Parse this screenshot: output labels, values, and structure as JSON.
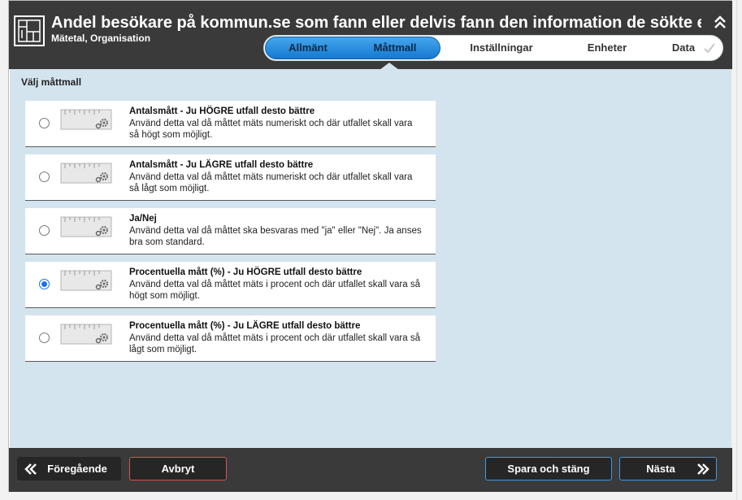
{
  "header": {
    "title": "Andel besökare på kommun.se som fann eller delvis fann den information de sökte efter",
    "subtitle": "Mätetal, Organisation"
  },
  "tabs": [
    {
      "label": "Allmänt",
      "active": false,
      "completed": true
    },
    {
      "label": "Måttmall",
      "active": true,
      "completed": true
    },
    {
      "label": "Inställningar",
      "active": false,
      "completed": false
    },
    {
      "label": "Enheter",
      "active": false,
      "completed": false
    },
    {
      "label": "Data",
      "active": false,
      "completed": false
    }
  ],
  "content": {
    "section_label": "Välj måttmall",
    "options": [
      {
        "title": "Antalsmått - Ju HÖGRE utfall desto bättre",
        "description": "Använd detta val då måttet mäts numeriskt och där utfallet skall vara så högt som möjligt.",
        "selected": false
      },
      {
        "title": "Antalsmått - Ju LÄGRE utfall desto bättre",
        "description": "Använd detta val då måttet mäts numeriskt och där utfallet skall vara så lågt som möjligt.",
        "selected": false
      },
      {
        "title": "Ja/Nej",
        "description": "Använd detta val då måttet ska besvaras med \"ja\" eller \"Nej\". Ja anses bra som standard.",
        "selected": false
      },
      {
        "title": "Procentuella mått (%) - Ju HÖGRE utfall desto bättre",
        "description": "Använd detta val då måttet mäts i procent och där utfallet skall vara så högt som möjligt.",
        "selected": true
      },
      {
        "title": "Procentuella mått (%) - Ju LÄGRE utfall desto bättre",
        "description": "Använd detta val då måttet mäts i procent och där utfallet skall vara så lågt som möjligt.",
        "selected": false
      }
    ]
  },
  "footer": {
    "prev_label": "Föregående",
    "cancel_label": "Avbryt",
    "save_label": "Spara och stäng",
    "next_label": "Nästa"
  },
  "icons": {
    "app": "measure-table-icon",
    "collapse": "double-chevron-up-icon",
    "tab_check": "checkmark-icon",
    "option": "ruler-gear-icon",
    "prev": "double-chevron-left-icon",
    "next": "double-chevron-right-icon"
  },
  "colors": {
    "header_bg": "#3a3a3a",
    "content_bg": "#d4e4ef",
    "accent_blue": "#1479d1",
    "cancel_border": "#d9534f",
    "primary_border": "#3d9be9"
  }
}
